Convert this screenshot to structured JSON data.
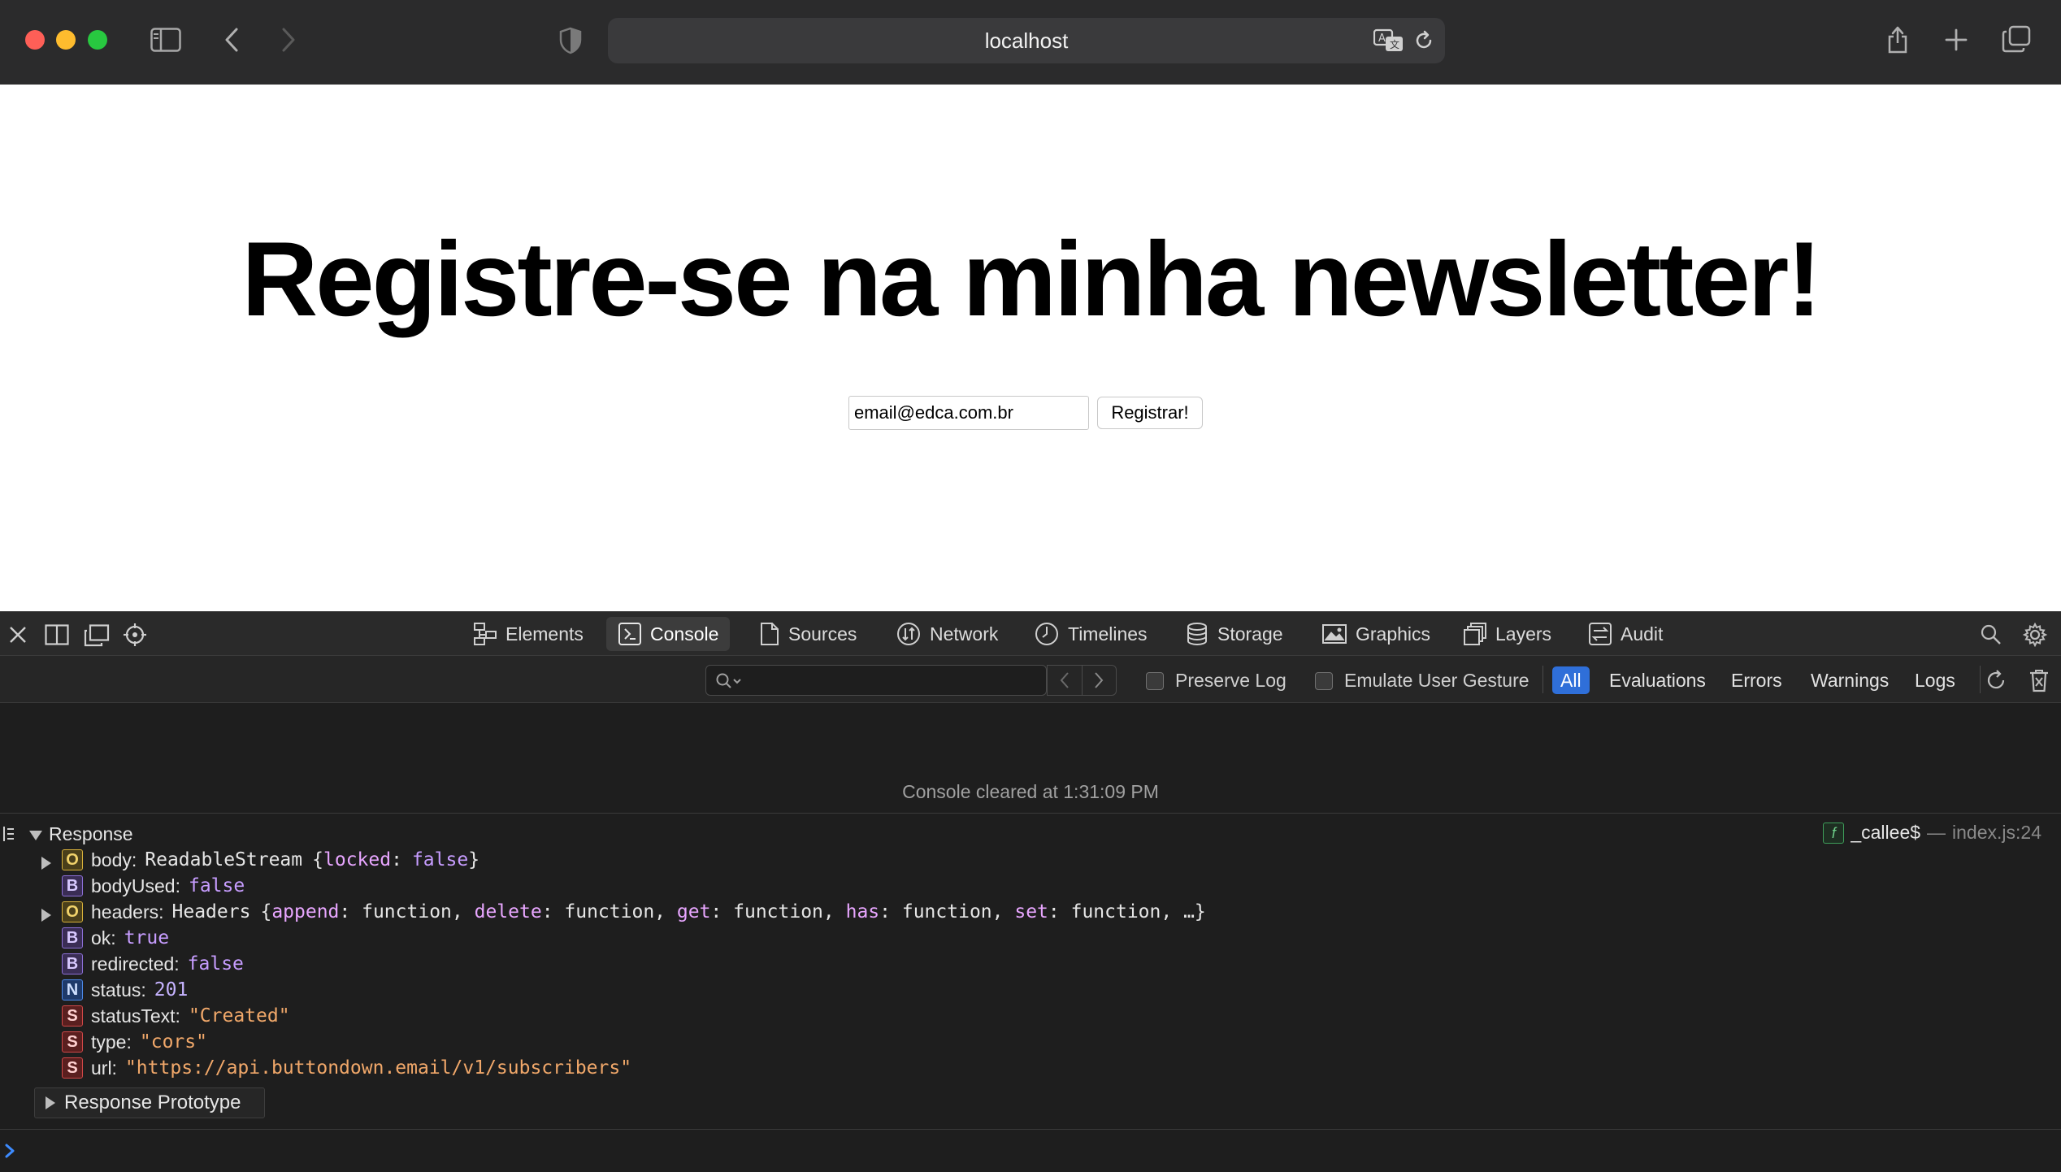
{
  "browser": {
    "address": "localhost"
  },
  "page": {
    "title": "Registre-se na minha newsletter!",
    "email_value": "email@edca.com.br",
    "submit_label": "Registrar!"
  },
  "devtools": {
    "tabs": [
      {
        "label": "Elements",
        "icon": "elements-icon"
      },
      {
        "label": "Console",
        "icon": "console-icon"
      },
      {
        "label": "Sources",
        "icon": "sources-icon"
      },
      {
        "label": "Network",
        "icon": "network-icon"
      },
      {
        "label": "Timelines",
        "icon": "timelines-icon"
      },
      {
        "label": "Storage",
        "icon": "storage-icon"
      },
      {
        "label": "Graphics",
        "icon": "graphics-icon"
      },
      {
        "label": "Layers",
        "icon": "layers-icon"
      },
      {
        "label": "Audit",
        "icon": "audit-icon"
      }
    ],
    "active_tab": "Console",
    "filters": {
      "preserve_log": "Preserve Log",
      "emulate_gesture": "Emulate User Gesture",
      "levels": [
        "All",
        "Evaluations",
        "Errors",
        "Warnings",
        "Logs"
      ],
      "active_level": "All"
    },
    "console": {
      "cleared_message": "Console cleared at 1:31:09 PM",
      "entry_title": "Response",
      "source_func": "_callee$",
      "source_dash": "—",
      "source_loc": "index.js:24",
      "props": [
        {
          "badge": "O",
          "key": "body:",
          "type": "ReadableStream",
          "open": "{",
          "k1": "locked",
          "colon": ":",
          "v1": "false",
          "close": "}"
        },
        {
          "badge": "B",
          "key": "bodyUsed:",
          "value": "false"
        },
        {
          "badge": "O",
          "key": "headers:",
          "type": "Headers",
          "open": "{",
          "items": [
            {
              "k": "append",
              "v": "function"
            },
            {
              "k": "delete",
              "v": "function"
            },
            {
              "k": "get",
              "v": "function"
            },
            {
              "k": "has",
              "v": "function"
            },
            {
              "k": "set",
              "v": "function"
            }
          ],
          "tail": "…}"
        },
        {
          "badge": "B",
          "key": "ok:",
          "value": "true"
        },
        {
          "badge": "B",
          "key": "redirected:",
          "value": "false"
        },
        {
          "badge": "N",
          "key": "status:",
          "value": "201"
        },
        {
          "badge": "S",
          "key": "statusText:",
          "value": "\"Created\""
        },
        {
          "badge": "S",
          "key": "type:",
          "value": "\"cors\""
        },
        {
          "badge": "S",
          "key": "url:",
          "value": "\"https://api.buttondown.email/v1/subscribers\""
        }
      ],
      "prototype_label": "Response Prototype"
    }
  },
  "colors": {
    "toolbar_bg": "#2b2b2c",
    "devtools_bg": "#1e1e1e",
    "accent": "#2f6fd9",
    "string": "#f1a86a",
    "keyword": "#e8a6ff"
  }
}
